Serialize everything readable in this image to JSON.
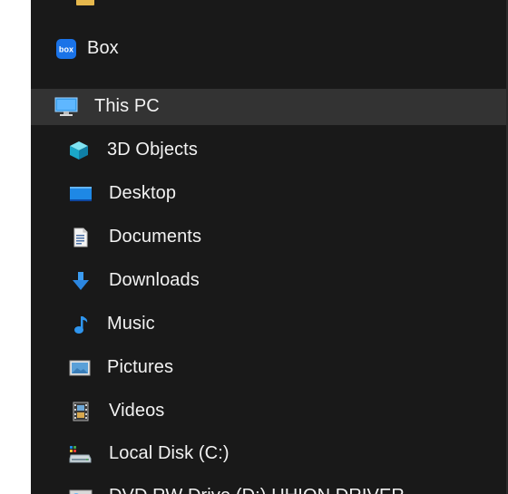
{
  "nav": {
    "items": [
      {
        "label": "Box",
        "icon": "box-icon"
      },
      {
        "label": "This PC",
        "icon": "computer-icon",
        "selected": true
      },
      {
        "label": "3D Objects",
        "icon": "3d-objects-icon"
      },
      {
        "label": "Desktop",
        "icon": "desktop-icon"
      },
      {
        "label": "Documents",
        "icon": "documents-icon"
      },
      {
        "label": "Downloads",
        "icon": "downloads-icon"
      },
      {
        "label": "Music",
        "icon": "music-icon"
      },
      {
        "label": "Pictures",
        "icon": "pictures-icon"
      },
      {
        "label": "Videos",
        "icon": "videos-icon"
      },
      {
        "label": "Local Disk (C:)",
        "icon": "local-disk-icon"
      },
      {
        "label": "DVD RW Drive (D:) UHION DRIVER",
        "icon": "dvd-drive-icon"
      }
    ]
  },
  "colors": {
    "pane_bg": "#191919",
    "selected_bg": "#333333",
    "text": "#f2f2f2",
    "accent": "#0a84ff"
  }
}
